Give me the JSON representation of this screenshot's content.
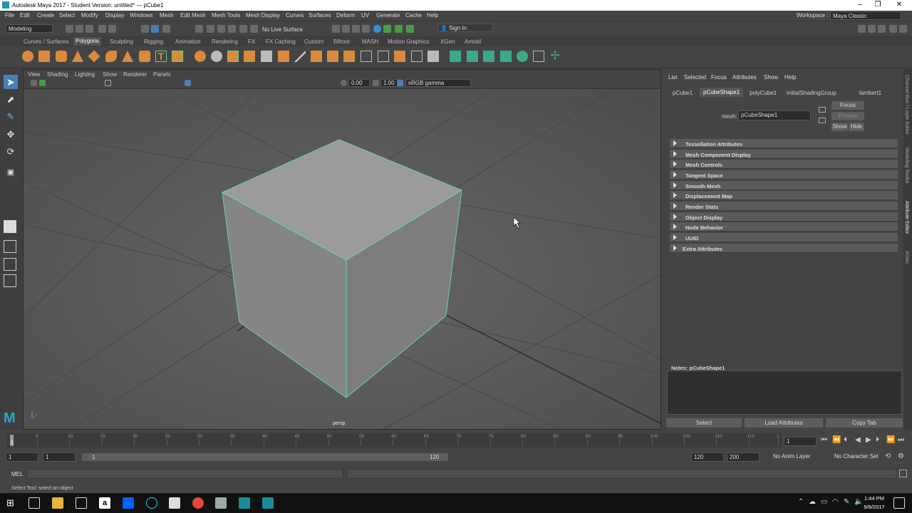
{
  "titlebar": {
    "title": "Autodesk Maya 2017 - Student Version: untitled*   ---   pCube1"
  },
  "menu": [
    "File",
    "Edit",
    "Create",
    "Select",
    "Modify",
    "Display",
    "Windows",
    "Mesh",
    "Edit Mesh",
    "Mesh Tools",
    "Mesh Display",
    "Curves",
    "Surfaces",
    "Deform",
    "UV",
    "Generate",
    "Cache",
    "Help"
  ],
  "workspace": {
    "label": "Workspace :",
    "value": "Maya Classic"
  },
  "status": {
    "mode": "Modeling",
    "live": "No Live Surface",
    "signin": "Sign In"
  },
  "shelf_tabs": [
    "Curves / Surfaces",
    "Polygons",
    "Sculpting",
    "Rigging",
    "Animation",
    "Rendering",
    "FX",
    "FX Caching",
    "Custom",
    "Bifrost",
    "MASH",
    "Motion Graphics",
    "XGen",
    "Arnold"
  ],
  "shelf_active": "Polygons",
  "viewport": {
    "menu": [
      "View",
      "Shading",
      "Lighting",
      "Show",
      "Renderer",
      "Panels"
    ],
    "field1": "0.00",
    "field2": "1.00",
    "colorspace": "sRGB gamma",
    "camera": "persp"
  },
  "ae": {
    "menu": [
      "List",
      "Selected",
      "Focus",
      "Attributes",
      "Show",
      "Help"
    ],
    "tabs": [
      "pCube1",
      "pCubeShape1",
      "polyCube1",
      "initialShadingGroup",
      "lambert1"
    ],
    "active_tab": "pCubeShape1",
    "mesh_label": "mesh:",
    "mesh_value": "pCubeShape1",
    "focus": "Focus",
    "presets": "Presets",
    "show": "Show",
    "hide": "Hide",
    "sections": [
      "Tessellation Attributes",
      "Mesh Component Display",
      "Mesh Controls",
      "Tangent Space",
      "Smooth Mesh",
      "Displacement Map",
      "Render Stats",
      "Object Display",
      "Node Behavior",
      "UUID",
      "Extra Attributes"
    ],
    "notes": "Notes:  pCubeShape1",
    "select": "Select",
    "load": "Load Attributes",
    "copy": "Copy Tab"
  },
  "sidetabs": [
    "Channel Box / Layer Editor",
    "Modeling Toolkit",
    "Attribute Editor",
    "XGen"
  ],
  "timeline": {
    "ticks": [
      "1",
      "5",
      "10",
      "15",
      "20",
      "25",
      "30",
      "35",
      "40",
      "45",
      "50",
      "55",
      "60",
      "65",
      "70",
      "75",
      "80",
      "85",
      "90",
      "95",
      "100",
      "105",
      "110",
      "115",
      "1"
    ],
    "current": "1"
  },
  "range": {
    "start": "1",
    "start2": "1",
    "slider_start": "1",
    "slider_end": "120",
    "end": "120",
    "end2": "200",
    "anim_layer": "No Anim Layer",
    "char_set": "No Character Set"
  },
  "mel": {
    "label": "MEL"
  },
  "help": "Select Tool: select an object",
  "clock": {
    "time": "1:44 PM",
    "date": "9/8/2017"
  }
}
